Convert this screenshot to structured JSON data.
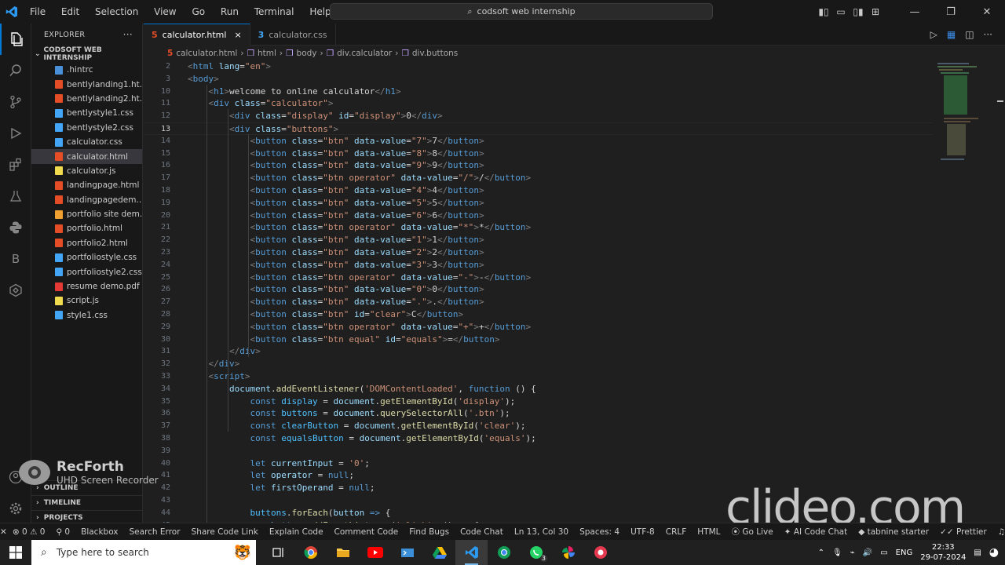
{
  "titlebar": {
    "menu": [
      "File",
      "Edit",
      "Selection",
      "View",
      "Go",
      "Run",
      "Terminal",
      "Help"
    ],
    "search": "codsoft web internship"
  },
  "sidebar": {
    "title": "EXPLORER",
    "more": "···",
    "folder": "CODSOFT WEB INTERNSHIP",
    "files": [
      {
        "name": ".hintrc",
        "color": "#4a90d9"
      },
      {
        "name": "bentlylanding1.ht...",
        "color": "#e44d26"
      },
      {
        "name": "bentlylanding2.ht...",
        "color": "#e44d26"
      },
      {
        "name": "bentlystyle1.css",
        "color": "#42a5f5"
      },
      {
        "name": "bentlystyle2.css",
        "color": "#42a5f5"
      },
      {
        "name": "calculator.css",
        "color": "#42a5f5"
      },
      {
        "name": "calculator.html",
        "color": "#e44d26"
      },
      {
        "name": "calculator.js",
        "color": "#f0db4f"
      },
      {
        "name": "landingpage.html",
        "color": "#e44d26"
      },
      {
        "name": "landingpagedem...",
        "color": "#e44d26"
      },
      {
        "name": "portfolio site dem...",
        "color": "#f0a030"
      },
      {
        "name": "portfolio.html",
        "color": "#e44d26"
      },
      {
        "name": "portfolio2.html",
        "color": "#e44d26"
      },
      {
        "name": "portfoliostyle.css",
        "color": "#42a5f5"
      },
      {
        "name": "portfoliostyle2.css",
        "color": "#42a5f5"
      },
      {
        "name": "resume demo.pdf",
        "color": "#e53935"
      },
      {
        "name": "script.js",
        "color": "#f0db4f"
      },
      {
        "name": "style1.css",
        "color": "#42a5f5"
      }
    ],
    "selected_file": "calculator.html",
    "outline": "OUTLINE",
    "timeline": "TIMELINE",
    "projects": "PROJECTS"
  },
  "tabs": [
    {
      "label": "calculator.html",
      "close": "×"
    },
    {
      "label": "calculator.css"
    }
  ],
  "breadcrumb": [
    "calculator.html",
    "html",
    "body",
    "div.calculator",
    "div.buttons"
  ],
  "editor": {
    "current_line": "13",
    "lines": [
      {
        "n": "2",
        "html": "<span class='g'>&lt;</span><span class='t'>html</span> <span class='a'>lang</span><span class='x'>=</span><span class='s'>\"en\"</span><span class='g'>&gt;</span>"
      },
      {
        "n": "3",
        "html": "<span class='g'>&lt;</span><span class='t'>body</span><span class='g'>&gt;</span>"
      },
      {
        "n": "10",
        "html": "    <span class='g'>&lt;</span><span class='t'>h1</span><span class='g'>&gt;</span><span class='x'>welcome to online calculator</span><span class='g'>&lt;/</span><span class='t'>h1</span><span class='g'>&gt;</span>"
      },
      {
        "n": "11",
        "html": "    <span class='g'>&lt;</span><span class='t'>div</span> <span class='a'>class</span><span class='x'>=</span><span class='s'>\"calculator\"</span><span class='g'>&gt;</span>"
      },
      {
        "n": "12",
        "html": "        <span class='g'>&lt;</span><span class='t'>div</span> <span class='a'>class</span><span class='x'>=</span><span class='s'>\"display\"</span> <span class='a'>id</span><span class='x'>=</span><span class='s'>\"display\"</span><span class='g'>&gt;</span><span class='x'>0</span><span class='g'>&lt;/</span><span class='t'>div</span><span class='g'>&gt;</span>"
      },
      {
        "n": "13",
        "html": "        <span class='g'>&lt;</span><span class='t'>div</span> <span class='a'>class</span><span class='x'>=</span><span class='s'>\"buttons\"</span><span class='g'>&gt;</span>"
      },
      {
        "n": "14",
        "html": "            <span class='g'>&lt;</span><span class='t'>button</span> <span class='a'>class</span><span class='x'>=</span><span class='s'>\"btn\"</span> <span class='a'>data-value</span><span class='x'>=</span><span class='s'>\"7\"</span><span class='g'>&gt;</span><span class='x'>7</span><span class='g'>&lt;/</span><span class='t'>button</span><span class='g'>&gt;</span>"
      },
      {
        "n": "15",
        "html": "            <span class='g'>&lt;</span><span class='t'>button</span> <span class='a'>class</span><span class='x'>=</span><span class='s'>\"btn\"</span> <span class='a'>data-value</span><span class='x'>=</span><span class='s'>\"8\"</span><span class='g'>&gt;</span><span class='x'>8</span><span class='g'>&lt;/</span><span class='t'>button</span><span class='g'>&gt;</span>"
      },
      {
        "n": "16",
        "html": "            <span class='g'>&lt;</span><span class='t'>button</span> <span class='a'>class</span><span class='x'>=</span><span class='s'>\"btn\"</span> <span class='a'>data-value</span><span class='x'>=</span><span class='s'>\"9\"</span><span class='g'>&gt;</span><span class='x'>9</span><span class='g'>&lt;/</span><span class='t'>button</span><span class='g'>&gt;</span>"
      },
      {
        "n": "17",
        "html": "            <span class='g'>&lt;</span><span class='t'>button</span> <span class='a'>class</span><span class='x'>=</span><span class='s'>\"btn operator\"</span> <span class='a'>data-value</span><span class='x'>=</span><span class='s'>\"/\"</span><span class='g'>&gt;</span><span class='x'>/</span><span class='g'>&lt;/</span><span class='t'>button</span><span class='g'>&gt;</span>"
      },
      {
        "n": "18",
        "html": "            <span class='g'>&lt;</span><span class='t'>button</span> <span class='a'>class</span><span class='x'>=</span><span class='s'>\"btn\"</span> <span class='a'>data-value</span><span class='x'>=</span><span class='s'>\"4\"</span><span class='g'>&gt;</span><span class='x'>4</span><span class='g'>&lt;/</span><span class='t'>button</span><span class='g'>&gt;</span>"
      },
      {
        "n": "19",
        "html": "            <span class='g'>&lt;</span><span class='t'>button</span> <span class='a'>class</span><span class='x'>=</span><span class='s'>\"btn\"</span> <span class='a'>data-value</span><span class='x'>=</span><span class='s'>\"5\"</span><span class='g'>&gt;</span><span class='x'>5</span><span class='g'>&lt;/</span><span class='t'>button</span><span class='g'>&gt;</span>"
      },
      {
        "n": "20",
        "html": "            <span class='g'>&lt;</span><span class='t'>button</span> <span class='a'>class</span><span class='x'>=</span><span class='s'>\"btn\"</span> <span class='a'>data-value</span><span class='x'>=</span><span class='s'>\"6\"</span><span class='g'>&gt;</span><span class='x'>6</span><span class='g'>&lt;/</span><span class='t'>button</span><span class='g'>&gt;</span>"
      },
      {
        "n": "21",
        "html": "            <span class='g'>&lt;</span><span class='t'>button</span> <span class='a'>class</span><span class='x'>=</span><span class='s'>\"btn operator\"</span> <span class='a'>data-value</span><span class='x'>=</span><span class='s'>\"*\"</span><span class='g'>&gt;</span><span class='x'>*</span><span class='g'>&lt;/</span><span class='t'>button</span><span class='g'>&gt;</span>"
      },
      {
        "n": "22",
        "html": "            <span class='g'>&lt;</span><span class='t'>button</span> <span class='a'>class</span><span class='x'>=</span><span class='s'>\"btn\"</span> <span class='a'>data-value</span><span class='x'>=</span><span class='s'>\"1\"</span><span class='g'>&gt;</span><span class='x'>1</span><span class='g'>&lt;/</span><span class='t'>button</span><span class='g'>&gt;</span>"
      },
      {
        "n": "23",
        "html": "            <span class='g'>&lt;</span><span class='t'>button</span> <span class='a'>class</span><span class='x'>=</span><span class='s'>\"btn\"</span> <span class='a'>data-value</span><span class='x'>=</span><span class='s'>\"2\"</span><span class='g'>&gt;</span><span class='x'>2</span><span class='g'>&lt;/</span><span class='t'>button</span><span class='g'>&gt;</span>"
      },
      {
        "n": "24",
        "html": "            <span class='g'>&lt;</span><span class='t'>button</span> <span class='a'>class</span><span class='x'>=</span><span class='s'>\"btn\"</span> <span class='a'>data-value</span><span class='x'>=</span><span class='s'>\"3\"</span><span class='g'>&gt;</span><span class='x'>3</span><span class='g'>&lt;/</span><span class='t'>button</span><span class='g'>&gt;</span>"
      },
      {
        "n": "25",
        "html": "            <span class='g'>&lt;</span><span class='t'>button</span> <span class='a'>class</span><span class='x'>=</span><span class='s'>\"btn operator\"</span> <span class='a'>data-value</span><span class='x'>=</span><span class='s'>\"-\"</span><span class='g'>&gt;</span><span class='x'>-</span><span class='g'>&lt;/</span><span class='t'>button</span><span class='g'>&gt;</span>"
      },
      {
        "n": "26",
        "html": "            <span class='g'>&lt;</span><span class='t'>button</span> <span class='a'>class</span><span class='x'>=</span><span class='s'>\"btn\"</span> <span class='a'>data-value</span><span class='x'>=</span><span class='s'>\"0\"</span><span class='g'>&gt;</span><span class='x'>0</span><span class='g'>&lt;/</span><span class='t'>button</span><span class='g'>&gt;</span>"
      },
      {
        "n": "27",
        "html": "            <span class='g'>&lt;</span><span class='t'>button</span> <span class='a'>class</span><span class='x'>=</span><span class='s'>\"btn\"</span> <span class='a'>data-value</span><span class='x'>=</span><span class='s'>\".\"</span><span class='g'>&gt;</span><span class='x'>.</span><span class='g'>&lt;/</span><span class='t'>button</span><span class='g'>&gt;</span>"
      },
      {
        "n": "28",
        "html": "            <span class='g'>&lt;</span><span class='t'>button</span> <span class='a'>class</span><span class='x'>=</span><span class='s'>\"btn\"</span> <span class='a'>id</span><span class='x'>=</span><span class='s'>\"clear\"</span><span class='g'>&gt;</span><span class='x'>C</span><span class='g'>&lt;/</span><span class='t'>button</span><span class='g'>&gt;</span>"
      },
      {
        "n": "29",
        "html": "            <span class='g'>&lt;</span><span class='t'>button</span> <span class='a'>class</span><span class='x'>=</span><span class='s'>\"btn operator\"</span> <span class='a'>data-value</span><span class='x'>=</span><span class='s'>\"+\"</span><span class='g'>&gt;</span><span class='x'>+</span><span class='g'>&lt;/</span><span class='t'>button</span><span class='g'>&gt;</span>"
      },
      {
        "n": "30",
        "html": "            <span class='g'>&lt;</span><span class='t'>button</span> <span class='a'>class</span><span class='x'>=</span><span class='s'>\"btn equal\"</span> <span class='a'>id</span><span class='x'>=</span><span class='s'>\"equals\"</span><span class='g'>&gt;</span><span class='x'>=</span><span class='g'>&lt;/</span><span class='t'>button</span><span class='g'>&gt;</span>"
      },
      {
        "n": "31",
        "html": "        <span class='g'>&lt;/</span><span class='t'>div</span><span class='g'>&gt;</span>"
      },
      {
        "n": "32",
        "html": "    <span class='g'>&lt;/</span><span class='t'>div</span><span class='g'>&gt;</span>"
      },
      {
        "n": "33",
        "html": "    <span class='g'>&lt;</span><span class='t'>script</span><span class='g'>&gt;</span>"
      },
      {
        "n": "34",
        "html": "        <span class='a'>document</span><span class='p'>.</span><span class='f'>addEventListener</span><span class='p'>(</span><span class='s'>'DOMContentLoaded'</span><span class='p'>, </span><span class='k'>function</span><span class='p'> () {</span>"
      },
      {
        "n": "35",
        "html": "            <span class='k'>const</span> <span class='v'>display</span> <span class='p'>=</span> <span class='a'>document</span><span class='p'>.</span><span class='f'>getElementById</span><span class='p'>(</span><span class='s'>'display'</span><span class='p'>);</span>"
      },
      {
        "n": "36",
        "html": "            <span class='k'>const</span> <span class='v'>buttons</span> <span class='p'>=</span> <span class='a'>document</span><span class='p'>.</span><span class='f'>querySelectorAll</span><span class='p'>(</span><span class='s'>'.btn'</span><span class='p'>);</span>"
      },
      {
        "n": "37",
        "html": "            <span class='k'>const</span> <span class='v'>clearButton</span> <span class='p'>=</span> <span class='a'>document</span><span class='p'>.</span><span class='f'>getElementById</span><span class='p'>(</span><span class='s'>'clear'</span><span class='p'>);</span>"
      },
      {
        "n": "38",
        "html": "            <span class='k'>const</span> <span class='v'>equalsButton</span> <span class='p'>=</span> <span class='a'>document</span><span class='p'>.</span><span class='f'>getElementById</span><span class='p'>(</span><span class='s'>'equals'</span><span class='p'>);</span>"
      },
      {
        "n": "39",
        "html": ""
      },
      {
        "n": "40",
        "html": "            <span class='k'>let</span> <span class='a'>currentInput</span> <span class='p'>=</span> <span class='s'>'0'</span><span class='p'>;</span>"
      },
      {
        "n": "41",
        "html": "            <span class='k'>let</span> <span class='a'>operator</span> <span class='p'>=</span> <span class='k'>null</span><span class='p'>;</span>"
      },
      {
        "n": "42",
        "html": "            <span class='k'>let</span> <span class='a'>firstOperand</span> <span class='p'>=</span> <span class='k'>null</span><span class='p'>;</span>"
      },
      {
        "n": "43",
        "html": ""
      },
      {
        "n": "44",
        "html": "            <span class='v'>buttons</span><span class='p'>.</span><span class='f'>forEach</span><span class='p'>(</span><span class='a'>button</span> <span class='k'>=&gt;</span><span class='p'> {</span>"
      },
      {
        "n": "45",
        "html": "                <span class='a'>button</span><span class='p'>.</span><span class='f'>addEventListener</span><span class='p'>(</span><span class='s'>'click'</span><span class='p'>, () </span><span class='k'>=&gt;</span><span class='p'> {</span>"
      }
    ]
  },
  "watermarks": {
    "recforth_title": "RecForth",
    "recforth_sub": "UHD Screen Recorder",
    "clideo": "clideo.com"
  },
  "statusbar": {
    "left": [
      "⊗ 0 ⚠ 0",
      "⚲ 0",
      "Blackbox",
      "Search Error",
      "Share Code Link",
      "Explain Code",
      "Comment Code",
      "Find Bugs",
      "Code Chat"
    ],
    "right": [
      "Ln 13, Col 30",
      "Spaces: 4",
      "UTF-8",
      "CRLF",
      "HTML",
      "Go Live",
      "AI Code Chat",
      "tabnine starter",
      "Prettier"
    ]
  },
  "taskbar": {
    "search_placeholder": "Type here to search",
    "lang": "ENG",
    "time": "22:33",
    "date": "29-07-2024",
    "whatsapp_badge": "3"
  }
}
